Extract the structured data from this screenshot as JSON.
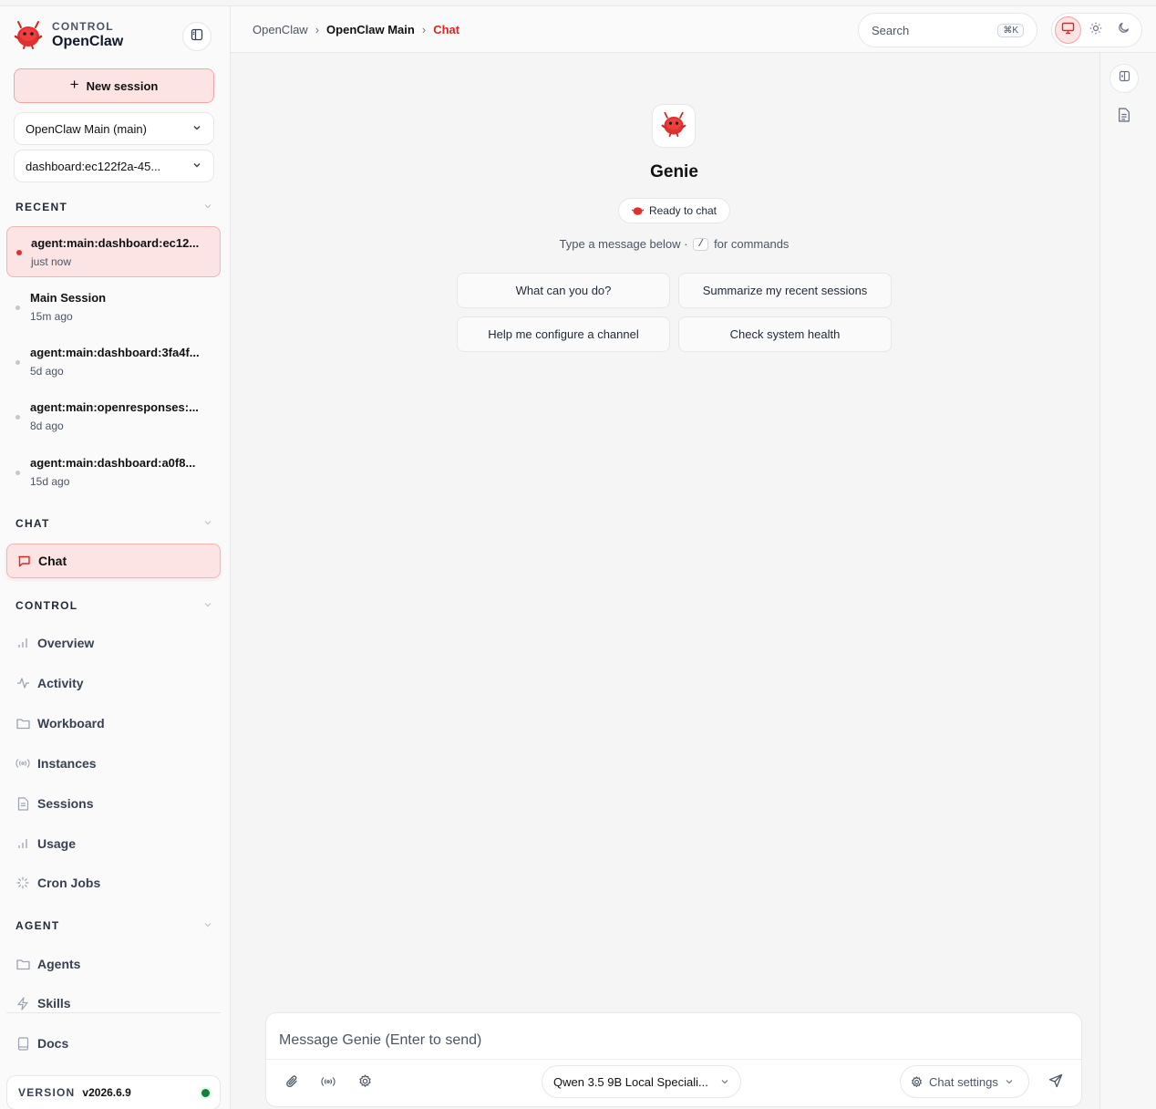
{
  "brand": {
    "eyebrow": "CONTROL",
    "title": "OpenClaw"
  },
  "sidebar": {
    "new_session": "New session",
    "agent_select": "OpenClaw Main (main)",
    "session_select": "dashboard:ec122f2a-45...",
    "recent_header": "RECENT",
    "recent": [
      {
        "title": "agent:main:dashboard:ec12...",
        "time": "just now"
      },
      {
        "title": "Main Session",
        "time": "15m ago"
      },
      {
        "title": "agent:main:dashboard:3fa4f...",
        "time": "5d ago"
      },
      {
        "title": "agent:main:openresponses:...",
        "time": "8d ago"
      },
      {
        "title": "agent:main:dashboard:a0f8...",
        "time": "15d ago"
      }
    ],
    "chat_header": "CHAT",
    "chat_item": "Chat",
    "control_header": "CONTROL",
    "control_items": [
      "Overview",
      "Activity",
      "Workboard",
      "Instances",
      "Sessions",
      "Usage",
      "Cron Jobs"
    ],
    "agent_header": "AGENT",
    "agent_items": [
      "Agents",
      "Skills"
    ],
    "docs": "Docs",
    "version_label": "VERSION",
    "version_value": "v2026.6.9"
  },
  "topbar": {
    "crumbs": [
      "OpenClaw",
      "OpenClaw Main",
      "Chat"
    ],
    "search_placeholder": "Search",
    "search_shortcut": "⌘K"
  },
  "main": {
    "assistant_name": "Genie",
    "status": "Ready to chat",
    "hint_before": "Type a message below ·",
    "hint_key": "/",
    "hint_after": "for commands",
    "suggestions": [
      "What can you do?",
      "Summarize my recent sessions",
      "Help me configure a channel",
      "Check system health"
    ],
    "composer_placeholder": "Message Genie (Enter to send)",
    "model": "Qwen 3.5 9B Local Speciali...",
    "chat_settings": "Chat settings"
  },
  "colors": {
    "accent": "#dc2626",
    "accent_soft": "#fde4e4",
    "status_ok": "#15803d"
  }
}
